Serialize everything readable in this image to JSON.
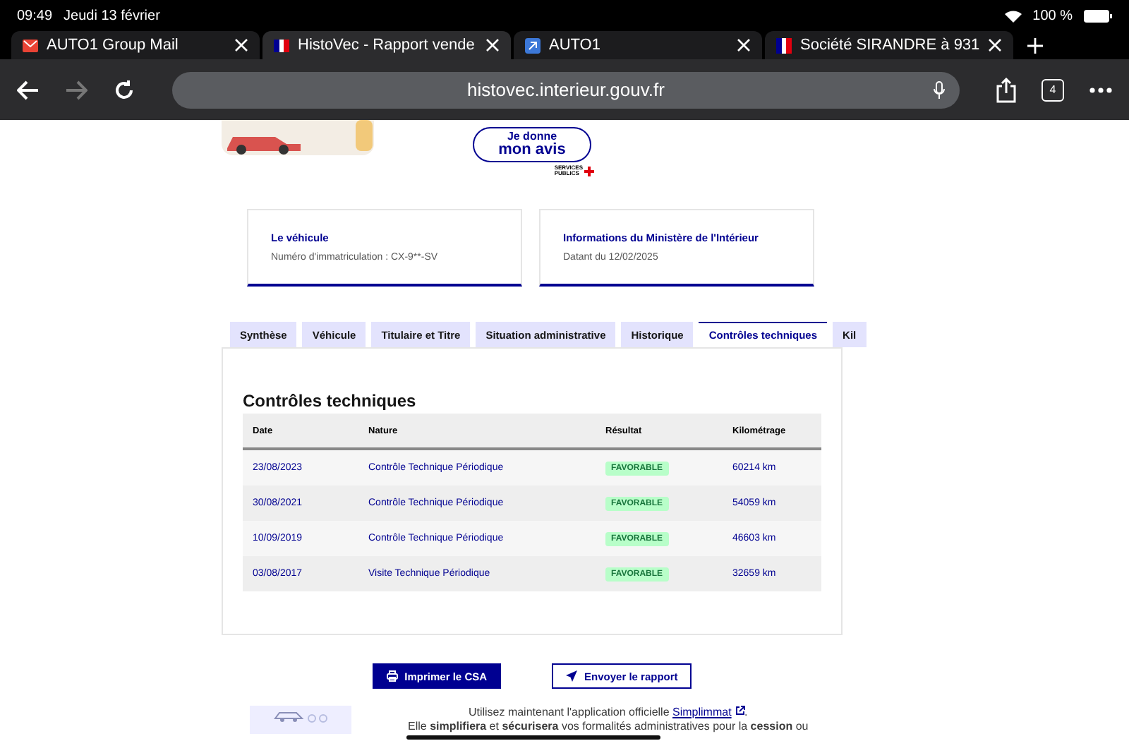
{
  "status_bar": {
    "time": "09:49",
    "date": "Jeudi 13 février",
    "battery": "100 %"
  },
  "browser_tabs": [
    {
      "title": "AUTO1 Group Mail",
      "kind": "mail",
      "selected": false
    },
    {
      "title": "HistoVec - Rapport vende",
      "kind": "flag",
      "selected": true
    },
    {
      "title": "AUTO1",
      "kind": "arrow",
      "selected": false
    },
    {
      "title": "Société SIRANDRE à 931",
      "kind": "marianne",
      "selected": false
    }
  ],
  "address_bar": {
    "url": "histovec.interieur.gouv.fr",
    "tab_count": "4"
  },
  "feedback_button": {
    "line1": "Je donne",
    "line2": "mon avis"
  },
  "services_logo": {
    "line1": "SERVICES",
    "line2": "PUBLICS"
  },
  "info_cards": [
    {
      "title": "Le véhicule",
      "text": "Numéro d'immatriculation : CX-9**-SV"
    },
    {
      "title": "Informations du Ministère de l'Intérieur",
      "text": "Datant du 12/02/2025"
    }
  ],
  "report_tabs": [
    {
      "label": "Synthèse",
      "selected": false
    },
    {
      "label": "Véhicule",
      "selected": false
    },
    {
      "label": "Titulaire et Titre",
      "selected": false
    },
    {
      "label": "Situation administrative",
      "selected": false
    },
    {
      "label": "Historique",
      "selected": false
    },
    {
      "label": "Contrôles techniques",
      "selected": true
    },
    {
      "label": "Kil",
      "selected": false
    }
  ],
  "section_title": "Contrôles techniques",
  "table": {
    "columns": [
      "Date",
      "Nature",
      "Résultat",
      "Kilométrage"
    ],
    "rows": [
      {
        "date": "23/08/2023",
        "nature": "Contrôle Technique Périodique",
        "result": "FAVORABLE",
        "km": "60214 km"
      },
      {
        "date": "30/08/2021",
        "nature": "Contrôle Technique Périodique",
        "result": "FAVORABLE",
        "km": "54059 km"
      },
      {
        "date": "10/09/2019",
        "nature": "Contrôle Technique Périodique",
        "result": "FAVORABLE",
        "km": "46603 km"
      },
      {
        "date": "03/08/2017",
        "nature": "Visite Technique Périodique",
        "result": "FAVORABLE",
        "km": "32659 km"
      }
    ]
  },
  "actions": [
    {
      "label": "Imprimer le CSA",
      "kind": "primary"
    },
    {
      "label": "Envoyer le rapport",
      "kind": "secondary"
    }
  ],
  "footer": {
    "lead": "Utilisez maintenant l'application officielle",
    "link": "Simplimmat",
    "end": ".",
    "second": "Elle **simplifiera** et **sécurisera** vos formalités administratives pour la **cession** ou"
  }
}
